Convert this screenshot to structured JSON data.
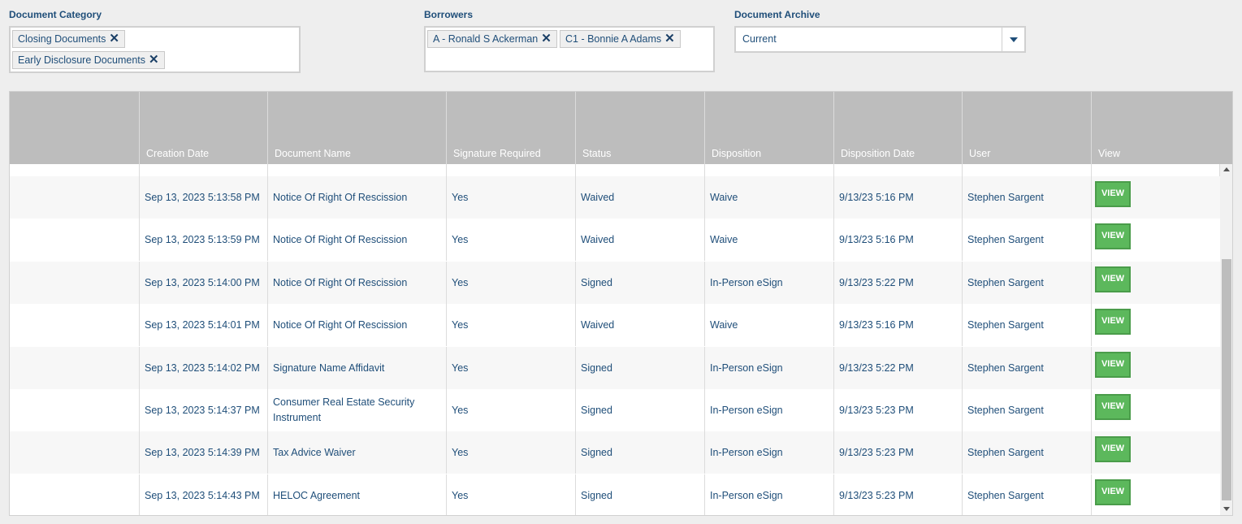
{
  "filters": {
    "category": {
      "label": "Document Category",
      "tags": [
        "Closing Documents",
        "Early Disclosure Documents"
      ]
    },
    "borrowers": {
      "label": "Borrowers",
      "tags": [
        "A - Ronald S Ackerman",
        "C1 - Bonnie A Adams"
      ]
    },
    "archive": {
      "label": "Document Archive",
      "value": "Current"
    },
    "remove_glyph": "✕"
  },
  "table": {
    "columns": [
      "",
      "Creation Date",
      "Document Name",
      "Signature Required",
      "Status",
      "Disposition",
      "Disposition Date",
      "User",
      "View"
    ],
    "view_label": "VIEW",
    "rows": [
      [
        "Sep 13, 2023 5:13:58 PM",
        "Notice Of Right Of Rescission",
        "Yes",
        "Waived",
        "Waive",
        "9/13/23 5:16 PM",
        "Stephen Sargent"
      ],
      [
        "Sep 13, 2023 5:13:59 PM",
        "Notice Of Right Of Rescission",
        "Yes",
        "Waived",
        "Waive",
        "9/13/23 5:16 PM",
        "Stephen Sargent"
      ],
      [
        "Sep 13, 2023 5:14:00 PM",
        "Notice Of Right Of Rescission",
        "Yes",
        "Signed",
        "In-Person eSign",
        "9/13/23 5:22 PM",
        "Stephen Sargent"
      ],
      [
        "Sep 13, 2023 5:14:01 PM",
        "Notice Of Right Of Rescission",
        "Yes",
        "Waived",
        "Waive",
        "9/13/23 5:16 PM",
        "Stephen Sargent"
      ],
      [
        "Sep 13, 2023 5:14:02 PM",
        "Signature Name Affidavit",
        "Yes",
        "Signed",
        "In-Person eSign",
        "9/13/23 5:22 PM",
        "Stephen Sargent"
      ],
      [
        "Sep 13, 2023 5:14:37 PM",
        "Consumer Real Estate Security Instrument",
        "Yes",
        "Signed",
        "In-Person eSign",
        "9/13/23 5:23 PM",
        "Stephen Sargent"
      ],
      [
        "Sep 13, 2023 5:14:39 PM",
        "Tax Advice Waiver",
        "Yes",
        "Signed",
        "In-Person eSign",
        "9/13/23 5:23 PM",
        "Stephen Sargent"
      ],
      [
        "Sep 13, 2023 5:14:43 PM",
        "HELOC Agreement",
        "Yes",
        "Signed",
        "In-Person eSign",
        "9/13/23 5:23 PM",
        "Stephen Sargent"
      ]
    ]
  },
  "colors": {
    "header_bg": "#bdbdbd",
    "text": "#1f4e79",
    "view_button": "#5cb85c"
  }
}
